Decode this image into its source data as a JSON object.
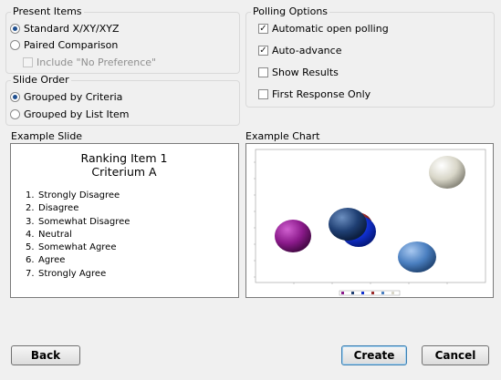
{
  "present_items": {
    "title": "Present Items",
    "options": [
      {
        "label": "Standard X/XY/XYZ",
        "selected": true
      },
      {
        "label": "Paired Comparison",
        "selected": false
      }
    ],
    "include_no_preference": {
      "label": "Include \"No Preference\"",
      "checked": false,
      "enabled": false
    }
  },
  "slide_order": {
    "title": "Slide Order",
    "options": [
      {
        "label": "Grouped by Criteria",
        "selected": true
      },
      {
        "label": "Grouped by List Item",
        "selected": false
      }
    ]
  },
  "polling_options": {
    "title": "Polling Options",
    "items": [
      {
        "label": "Automatic open polling",
        "checked": true
      },
      {
        "label": "Auto-advance",
        "checked": true
      },
      {
        "label": "Show Results",
        "checked": false
      },
      {
        "label": "First Response Only",
        "checked": false
      }
    ]
  },
  "example_slide": {
    "label": "Example Slide",
    "title_line1": "Ranking Item 1",
    "title_line2": "Criterium A",
    "items": [
      {
        "num": "1.",
        "text": "Strongly Disagree"
      },
      {
        "num": "2.",
        "text": "Disagree"
      },
      {
        "num": "3.",
        "text": "Somewhat Disagree"
      },
      {
        "num": "4.",
        "text": "Neutral"
      },
      {
        "num": "5.",
        "text": "Somewhat Agree"
      },
      {
        "num": "6.",
        "text": "Agree"
      },
      {
        "num": "7.",
        "text": "Strongly Agree"
      }
    ]
  },
  "example_chart": {
    "label": "Example Chart",
    "bubble_colors": [
      "#8b1a8b",
      "#1f3f73",
      "#1030d0",
      "#9b2a2a",
      "#4a7fc0",
      "#d8d6c8"
    ]
  },
  "buttons": {
    "back": "Back",
    "create": "Create",
    "cancel": "Cancel"
  }
}
